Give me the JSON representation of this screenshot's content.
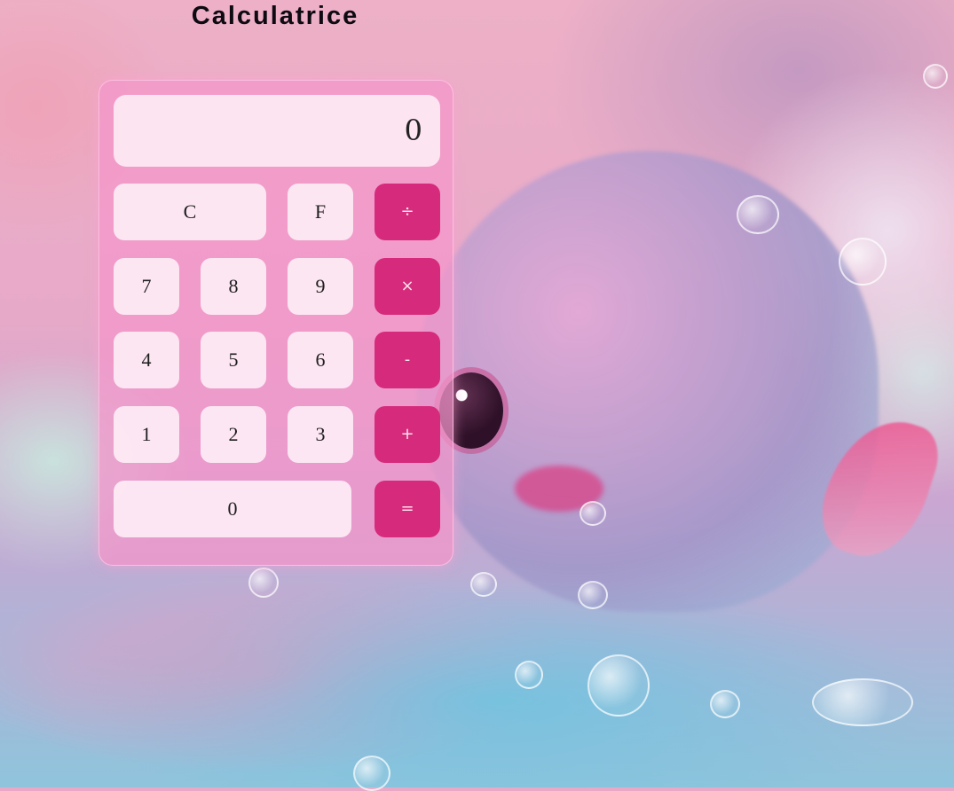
{
  "page": {
    "title": "Calculatrice"
  },
  "calculator": {
    "display_value": "0",
    "keys": {
      "clear": "C",
      "f": "F",
      "divide": "÷",
      "seven": "7",
      "eight": "8",
      "nine": "9",
      "multiply": "×",
      "four": "4",
      "five": "5",
      "six": "6",
      "minus": "-",
      "one": "1",
      "two": "2",
      "three": "3",
      "plus": "+",
      "zero": "0",
      "equals": "="
    }
  },
  "colors": {
    "operator_key": "#d62a7c",
    "digit_key": "#fdecf5",
    "panel": "#f496ca"
  }
}
